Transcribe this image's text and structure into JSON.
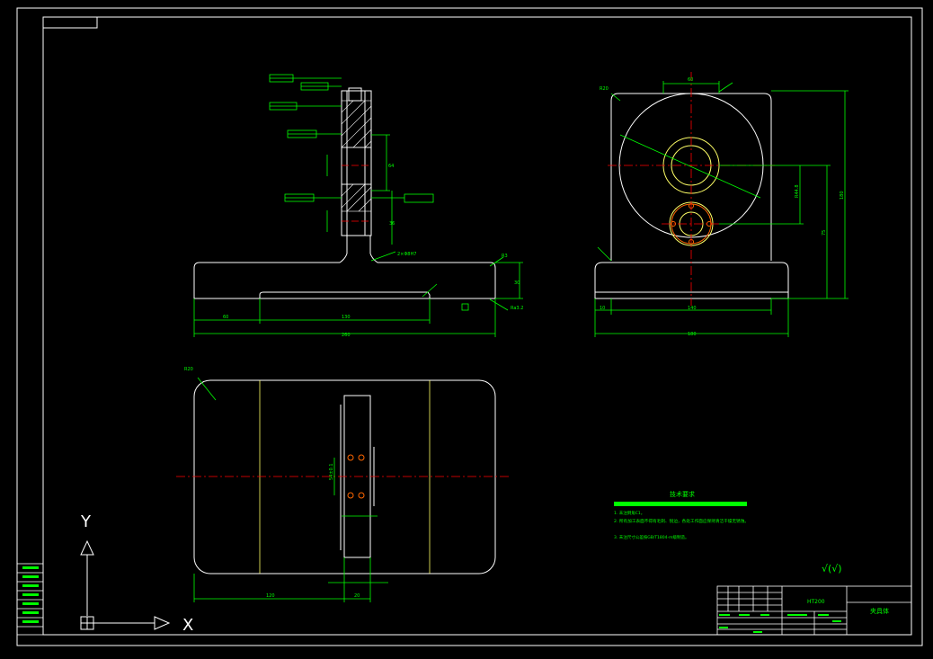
{
  "drawing": {
    "colors": {
      "background": "#000000",
      "outline": "#ffffff",
      "dimension": "#00ff00",
      "centerline": "#ff0000",
      "hidden": "#ffff66",
      "hole": "#ff6600"
    },
    "technical_requirements": {
      "title": "技术要求",
      "lines": [
        "1. 未注倒角C1。",
        "2. 所有加工表面不得有毛刺、锐边，各处工作面应保持清洁干燥无锈蚀。",
        "3. 未注尺寸公差按GB/T1804-m级制造。"
      ]
    },
    "title_block": {
      "part_name": "夹具体",
      "material": "HT200"
    },
    "ucs": {
      "y_label": "Y",
      "x_label": "X"
    },
    "roughness_symbol": "√(√)"
  }
}
